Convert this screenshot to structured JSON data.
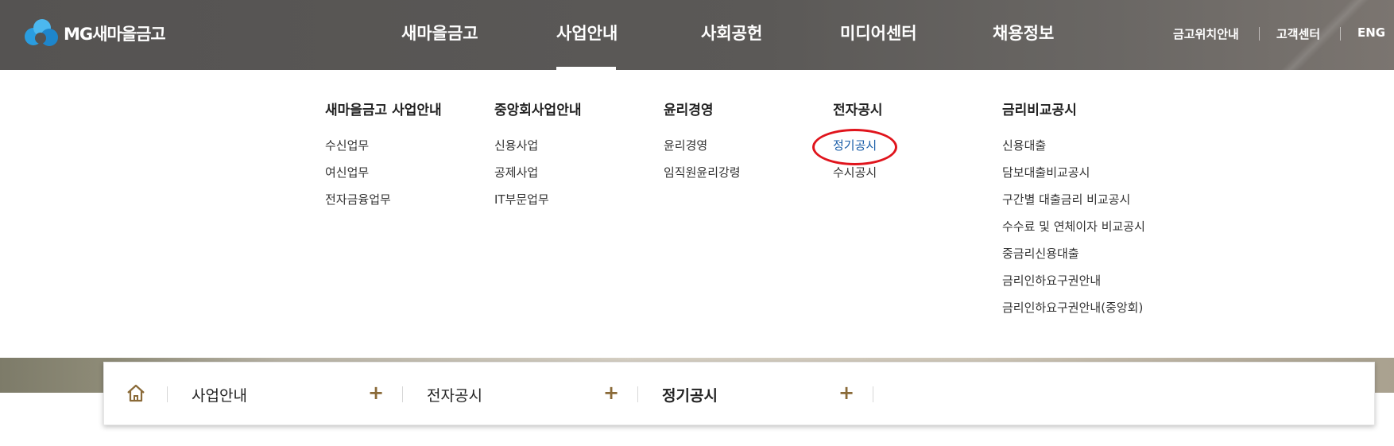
{
  "logo": {
    "text": "MG새마을금고"
  },
  "gnb": [
    {
      "label": "새마을금고"
    },
    {
      "label": "사업안내"
    },
    {
      "label": "사회공헌"
    },
    {
      "label": "미디어센터"
    },
    {
      "label": "채용정보"
    }
  ],
  "util": [
    {
      "label": "금고위치안내"
    },
    {
      "label": "고객센터"
    },
    {
      "label": "ENG"
    }
  ],
  "mega": [
    {
      "title": "새마을금고 사업안내",
      "items": [
        "수신업무",
        "여신업무",
        "전자금융업무"
      ]
    },
    {
      "title": "중앙회사업안내",
      "items": [
        "신용사업",
        "공제사업",
        "IT부문업무"
      ]
    },
    {
      "title": "윤리경영",
      "items": [
        "윤리경영",
        "임직원윤리강령"
      ]
    },
    {
      "title": "전자공시",
      "items": [
        "정기공시",
        "수시공시"
      ]
    },
    {
      "title": "금리비교공시",
      "items": [
        "신용대출",
        "담보대출비교공시",
        "구간별 대출금리 비교공시",
        "수수료 및 연체이자 비교공시",
        "중금리신용대출",
        "금리인하요구권안내",
        "금리인하요구권안내(중앙회)"
      ]
    }
  ],
  "breadcrumb": {
    "items": [
      {
        "label": "사업안내"
      },
      {
        "label": "전자공시"
      },
      {
        "label": "정기공시"
      }
    ],
    "plus": "+"
  },
  "colors": {
    "header_bg": "#555352",
    "active_link": "#1a5ea8",
    "annotation_circle": "#e0141c",
    "plus": "#8a6a38"
  }
}
